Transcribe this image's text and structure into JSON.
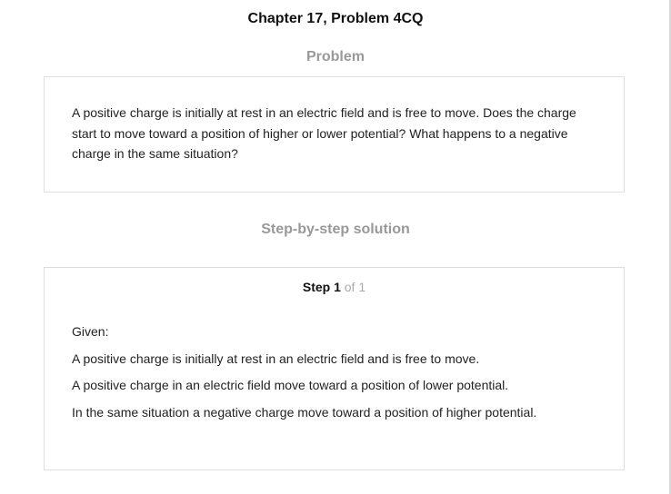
{
  "page_title": "Chapter 17, Problem 4CQ",
  "problem": {
    "heading": "Problem",
    "text": "A positive charge is initially at rest in an electric field and is free to move. Does the charge start to move toward a position of higher or lower potential? What happens to a negative charge in the same situation?"
  },
  "solution": {
    "heading": "Step-by-step solution",
    "step": {
      "label": "Step 1",
      "of_total": "of 1",
      "lines": [
        "Given:",
        "A positive charge is initially at rest in an electric field and is free to move.",
        "A positive charge in an electric field move toward a position of lower potential.",
        "In the same situation a negative charge move toward a position of higher potential."
      ]
    }
  }
}
